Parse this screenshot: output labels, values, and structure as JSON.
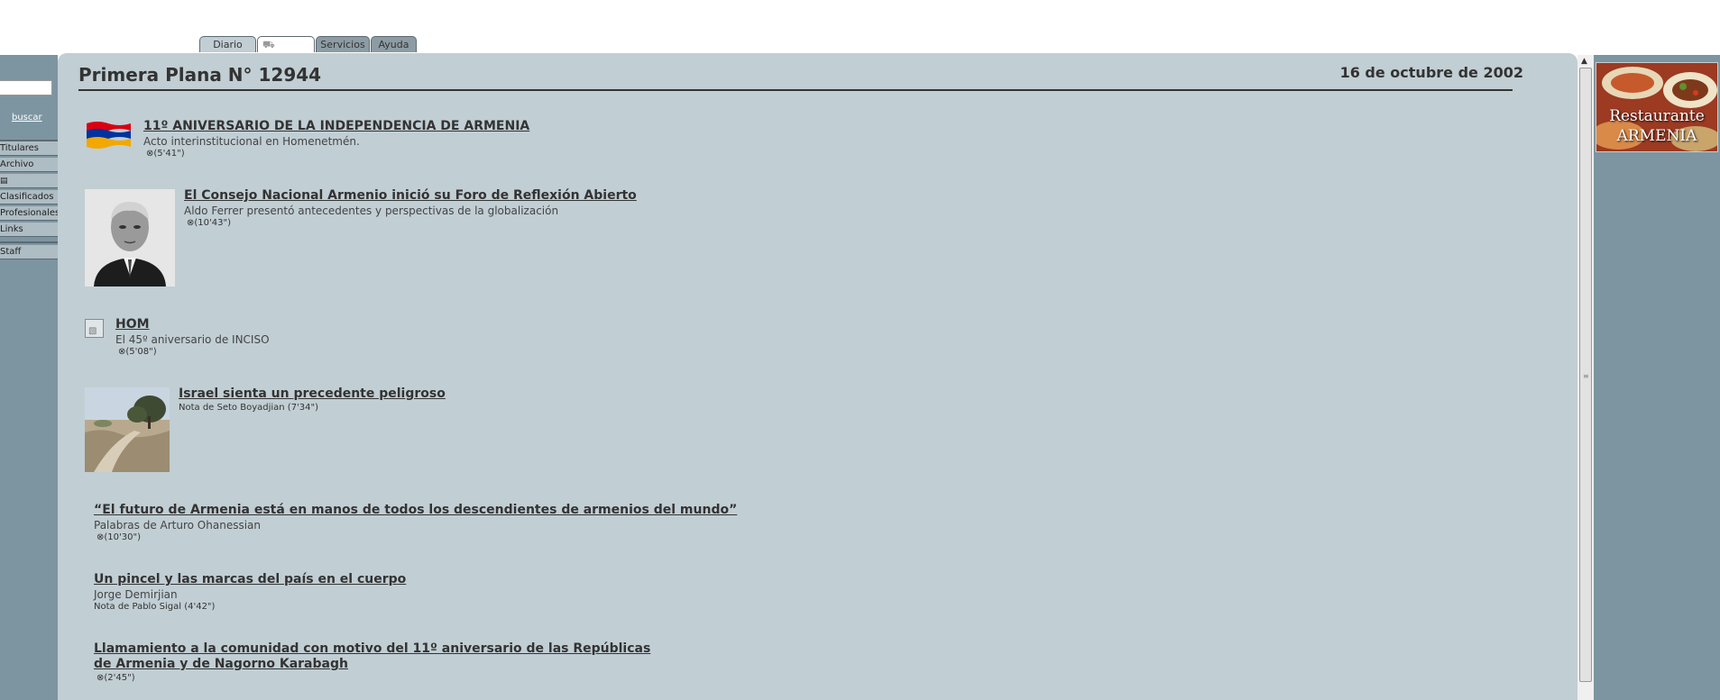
{
  "tabs": {
    "diario": "Diario",
    "servicios": "Servicios",
    "ayuda": "Ayuda"
  },
  "sidebar": {
    "search_link": "buscar",
    "items": [
      "Titulares",
      "Archivo",
      "",
      "Clasificados",
      "Profesionales",
      "Links",
      "Staff"
    ]
  },
  "main": {
    "title": "Primera Plana N° 12944",
    "date": "16 de octubre de 2002",
    "articles": [
      {
        "headline": "11º ANIVERSARIO DE LA INDEPENDENCIA DE ARMENIA",
        "subtitle": "Acto interinstitucional en Homenetmén.",
        "duration": "(5'41\")"
      },
      {
        "headline": "El Consejo Nacional Armenio inició su Foro de Reflexión Abierto",
        "subtitle": "Aldo Ferrer presentó antecedentes y perspectivas de la globalización",
        "duration": "(10'43\")"
      },
      {
        "headline": "HOM",
        "subtitle": "El 45º aniversario de INCISO",
        "duration": "(5'08\")"
      },
      {
        "headline": "Israel sienta un precedente peligroso",
        "meta": "Nota de Seto Boyadjian (7'34\")"
      },
      {
        "headline": "“El futuro de Armenia está en manos de todos los descendientes de armenios del mundo”",
        "subtitle": "Palabras de Arturo Ohanessian",
        "duration": "(10'30\")"
      },
      {
        "headline": "Un pincel y las marcas del país en el cuerpo",
        "subtitle": "Jorge Demirjian",
        "meta": "Nota de Pablo Sigal (4'42\")"
      },
      {
        "headline_line1": "Llamamiento a la comunidad con motivo del 11º aniversario de las Repúblicas",
        "headline_line2": "de Armenia y de Nagorno Karabagh",
        "duration": "(2'45\")"
      }
    ]
  },
  "ad": {
    "line1": "Restaurante",
    "line2": "ARMENIA"
  }
}
